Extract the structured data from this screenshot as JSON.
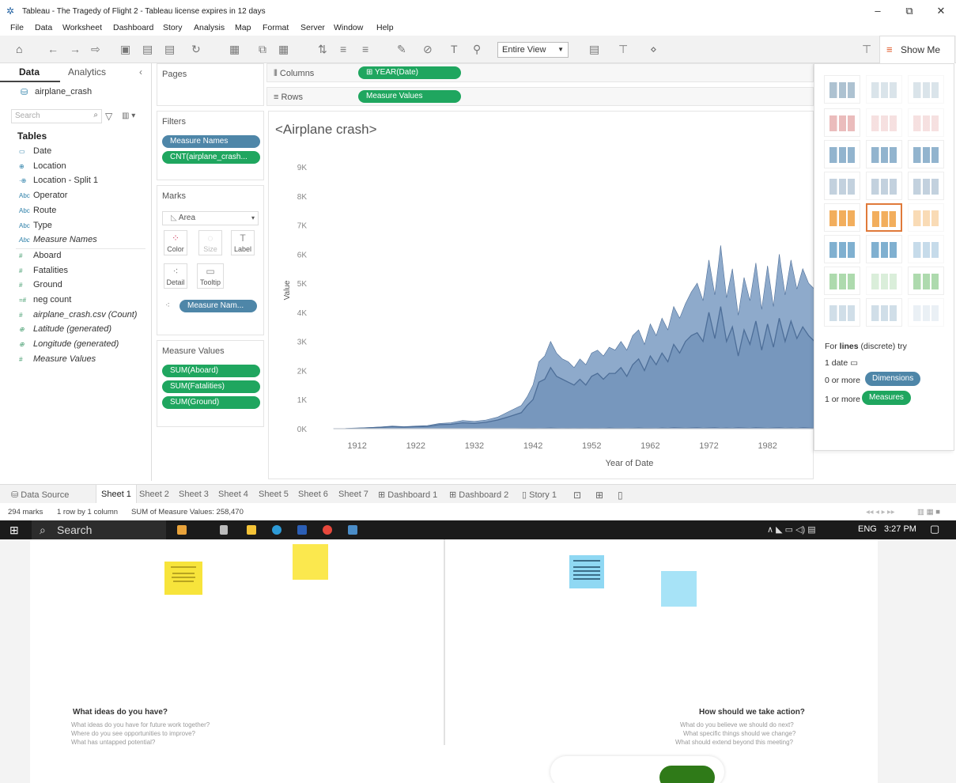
{
  "window": {
    "title": "Tableau - The Tragedy of Flight 2 - Tableau license expires in 12 days",
    "controls": {
      "minimize": "–",
      "maximize": "⧉",
      "close": "✕"
    }
  },
  "menu": [
    "File",
    "Data",
    "Worksheet",
    "Dashboard",
    "Story",
    "Analysis",
    "Map",
    "Format",
    "Server",
    "Window",
    "Help"
  ],
  "toolbar": {
    "fit": "Entire View",
    "show_me": "Show Me"
  },
  "data_pane": {
    "tab_data": "Data",
    "tab_analytics": "Analytics",
    "datasource": "airplane_crash",
    "search_placeholder": "Search",
    "tables_heading": "Tables",
    "fields": [
      {
        "icon": "calendar-icon",
        "glyph": "▭",
        "name": "Date",
        "italic": false,
        "kind": "dim"
      },
      {
        "icon": "globe-icon",
        "glyph": "⊕",
        "name": "Location",
        "italic": false,
        "kind": "dim"
      },
      {
        "icon": "globe-icon",
        "glyph": "·⊕",
        "name": "Location - Split 1",
        "italic": false,
        "kind": "dim"
      },
      {
        "icon": "abc-icon",
        "glyph": "Abc",
        "name": "Operator",
        "italic": false,
        "kind": "dim"
      },
      {
        "icon": "abc-icon",
        "glyph": "Abc",
        "name": "Route",
        "italic": false,
        "kind": "dim"
      },
      {
        "icon": "abc-icon",
        "glyph": "Abc",
        "name": "Type",
        "italic": false,
        "kind": "dim"
      },
      {
        "icon": "abc-icon",
        "glyph": "Abc",
        "name": "Measure Names",
        "italic": true,
        "kind": "dim"
      },
      {
        "icon": "hash-icon",
        "glyph": "#",
        "name": "Aboard",
        "italic": false,
        "kind": "m"
      },
      {
        "icon": "hash-icon",
        "glyph": "#",
        "name": "Fatalities",
        "italic": false,
        "kind": "m"
      },
      {
        "icon": "hash-icon",
        "glyph": "#",
        "name": "Ground",
        "italic": false,
        "kind": "m"
      },
      {
        "icon": "hash-icon",
        "glyph": "=#",
        "name": "neg count",
        "italic": false,
        "kind": "m"
      },
      {
        "icon": "hash-icon",
        "glyph": "#",
        "name": "airplane_crash.csv (Count)",
        "italic": true,
        "kind": "m"
      },
      {
        "icon": "globe-icon",
        "glyph": "⊕",
        "name": "Latitude (generated)",
        "italic": true,
        "kind": "m"
      },
      {
        "icon": "globe-icon",
        "glyph": "⊕",
        "name": "Longitude (generated)",
        "italic": true,
        "kind": "m"
      },
      {
        "icon": "hash-icon",
        "glyph": "#",
        "name": "Measure Values",
        "italic": true,
        "kind": "m"
      }
    ]
  },
  "pages": {
    "label": "Pages"
  },
  "filters": {
    "label": "Filters",
    "items": [
      "Measure Names",
      "CNT(airplane_crash..."
    ]
  },
  "marks": {
    "label": "Marks",
    "type": "Area",
    "buttons": [
      "Color",
      "Size",
      "Label",
      "Detail",
      "Tooltip"
    ],
    "pill": "Measure Nam..."
  },
  "measure_values": {
    "label": "Measure Values",
    "items": [
      "SUM(Aboard)",
      "SUM(Fatalities)",
      "SUM(Ground)"
    ]
  },
  "shelves": {
    "columns_label": "Columns",
    "columns_pill": "⊞ YEAR(Date)",
    "rows_label": "Rows",
    "rows_pill": "Measure Values"
  },
  "show_me": {
    "hint_pre": "For ",
    "hint_bold": "lines",
    "hint_post": " (discrete) try",
    "req1": "1 date",
    "req2_pre": "0 or more",
    "req2_pill": "Dimensions",
    "req3_pre": "1 or more",
    "req3_pill": "Measures"
  },
  "chart_data": {
    "type": "area",
    "title": "<Airplane crash>",
    "xlabel": "Year of Date",
    "ylabel": "Value",
    "x_ticks": [
      1912,
      1922,
      1932,
      1942,
      1952,
      1962,
      1972,
      1982
    ],
    "y_ticks": [
      "0K",
      "1K",
      "2K",
      "3K",
      "4K",
      "5K",
      "6K",
      "7K",
      "8K",
      "9K"
    ],
    "xlim": [
      1908,
      1990
    ],
    "ylim": [
      0,
      9600
    ],
    "x": [
      1908,
      1910,
      1912,
      1914,
      1916,
      1918,
      1920,
      1922,
      1924,
      1926,
      1928,
      1930,
      1932,
      1934,
      1936,
      1938,
      1940,
      1941,
      1942,
      1943,
      1944,
      1945,
      1946,
      1947,
      1948,
      1949,
      1950,
      1951,
      1952,
      1953,
      1954,
      1955,
      1956,
      1957,
      1958,
      1959,
      1960,
      1961,
      1962,
      1963,
      1964,
      1965,
      1966,
      1967,
      1968,
      1969,
      1970,
      1971,
      1972,
      1973,
      1974,
      1975,
      1976,
      1977,
      1978,
      1979,
      1980,
      1981,
      1982,
      1983,
      1984,
      1985,
      1986,
      1987,
      1988,
      1989,
      1990
    ],
    "series": [
      {
        "name": "Aboard",
        "values": [
          2,
          5,
          20,
          40,
          60,
          90,
          70,
          90,
          110,
          180,
          200,
          280,
          250,
          300,
          400,
          600,
          800,
          1100,
          1500,
          2300,
          2500,
          3000,
          2600,
          2400,
          2300,
          2100,
          2400,
          2200,
          2600,
          2700,
          2500,
          2800,
          2700,
          3000,
          2700,
          3200,
          3400,
          2900,
          3600,
          3200,
          3800,
          3400,
          4200,
          3800,
          4300,
          4700,
          5000,
          4400,
          5800,
          4600,
          6300,
          4500,
          5500,
          3900,
          5200,
          4400,
          5700,
          4100,
          5600,
          4200,
          6000,
          4600,
          5800,
          4800,
          5500,
          5000,
          4800
        ]
      },
      {
        "name": "Fatalities",
        "values": [
          1,
          3,
          15,
          30,
          45,
          70,
          55,
          70,
          80,
          140,
          150,
          200,
          180,
          220,
          300,
          420,
          550,
          800,
          1000,
          1600,
          1700,
          2100,
          1800,
          1700,
          1600,
          1500,
          1700,
          1500,
          1800,
          1900,
          1700,
          1900,
          1900,
          2100,
          1800,
          2200,
          2400,
          2000,
          2500,
          2200,
          2600,
          2300,
          2900,
          2600,
          3000,
          3200,
          3300,
          3000,
          4000,
          3100,
          4200,
          3000,
          3500,
          2500,
          3400,
          2900,
          3700,
          2700,
          3600,
          2800,
          3800,
          3000,
          3700,
          3100,
          3500,
          3200,
          3000
        ]
      },
      {
        "name": "Ground",
        "values": [
          0,
          0,
          0,
          0,
          0,
          0,
          0,
          0,
          0,
          0,
          0,
          0,
          0,
          0,
          0,
          0,
          10,
          10,
          20,
          10,
          20,
          30,
          20,
          10,
          20,
          10,
          20,
          10,
          20,
          20,
          10,
          30,
          20,
          20,
          10,
          20,
          30,
          20,
          20,
          10,
          30,
          20,
          40,
          30,
          20,
          30,
          40,
          20,
          30,
          40,
          20,
          30,
          20,
          40,
          30,
          20,
          40,
          30,
          20,
          30,
          40,
          20,
          30,
          20,
          40,
          30,
          20
        ]
      }
    ]
  },
  "sheet_tabs": [
    "Data Source",
    "Sheet 1",
    "Sheet 2",
    "Sheet 3",
    "Sheet 4",
    "Sheet 5",
    "Sheet 6",
    "Sheet 7",
    "Dashboard 1",
    "Dashboard 2",
    "Story 1"
  ],
  "status": {
    "marks": "294 marks",
    "dims": "1 row by 1 column",
    "sum": "SUM of Measure Values: 258,470"
  },
  "taskbar": {
    "search": "Search",
    "lang": "ENG",
    "time": "3:27 PM"
  },
  "board": {
    "left_title": "What ideas do you have?",
    "left_sub": [
      "What ideas do you have for future work together?",
      "Where do you see opportunities to improve?",
      "What has untapped potential?"
    ],
    "right_title": "How should we take action?",
    "right_sub": [
      "What do you believe we should do next?",
      "What specific things should we change?",
      "What should extend beyond this meeting?"
    ]
  }
}
